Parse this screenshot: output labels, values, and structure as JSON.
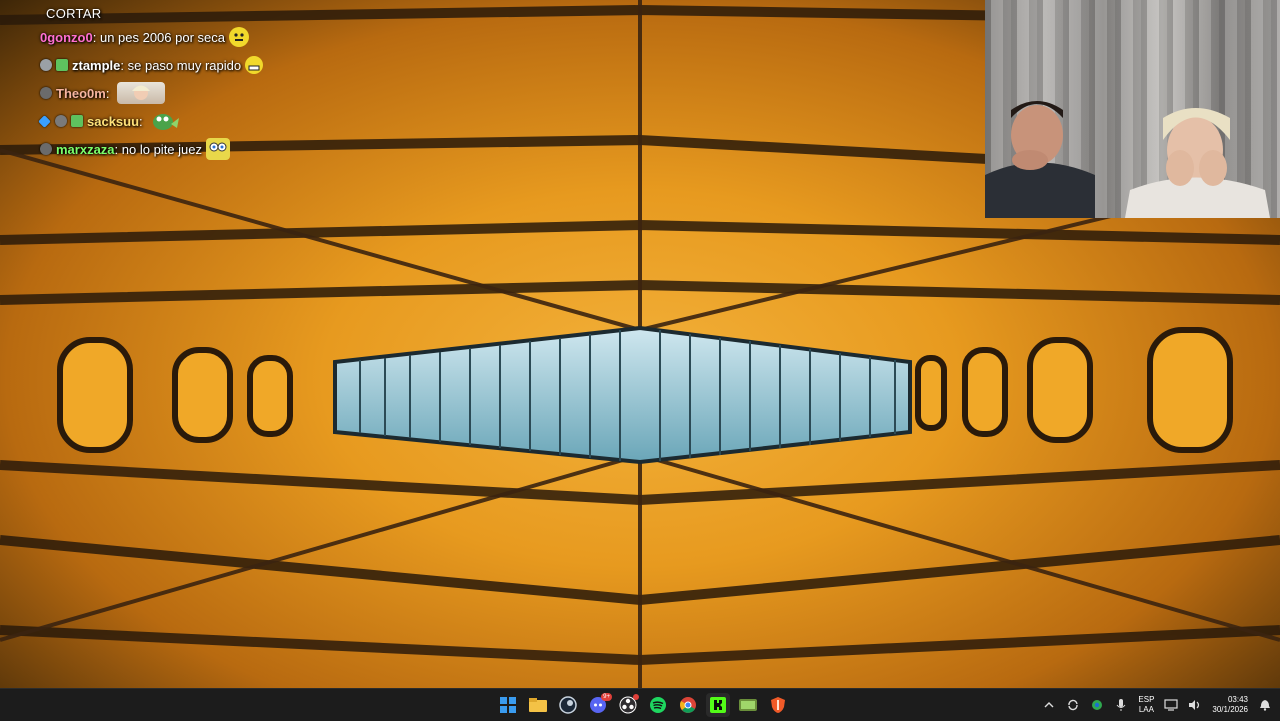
{
  "chat": {
    "title": "CORTAR",
    "messages": [
      {
        "user": "0gonzo0",
        "text": ": un pes 2006 por seca",
        "user_color": "#ff6fd0",
        "badge_colors": [],
        "emote": "neutral-face"
      },
      {
        "user": "ztample",
        "text": ": se paso muy rapido",
        "user_color": "#ffffff",
        "badge_colors": [
          "#9aa0a6",
          "#5ec25e"
        ],
        "emote": "grimace-face"
      },
      {
        "user": "Theo0m",
        "text": ":",
        "user_color": "#f7b5a0",
        "badge_colors": [
          "#6b6b6b"
        ],
        "emote": "girl-face"
      },
      {
        "user": "sacksuu",
        "text": ":",
        "user_color": "#ffe27a",
        "badge_colors": [
          "#3aa0ff",
          "#7a7a7a",
          "#5ec25e"
        ],
        "emote": "pepe-frog"
      },
      {
        "user": "marxzaza",
        "text": ": no lo pite juez",
        "user_color": "#7cff6b",
        "badge_colors": [
          "#6b6b6b"
        ],
        "emote": "spongebob"
      }
    ]
  },
  "webcam": {
    "description_icon": "webcam-feed"
  },
  "taskbar": {
    "apps": [
      {
        "name": "windows-start-icon",
        "color": "#3a9cf0"
      },
      {
        "name": "file-explorer-icon",
        "color": "#f4c246"
      },
      {
        "name": "steam-icon",
        "color": "#c9d4df"
      },
      {
        "name": "discord-icon",
        "color": "#5865f2",
        "badge": "9+"
      },
      {
        "name": "obs-icon",
        "color": "#ffffff"
      },
      {
        "name": "spotify-icon",
        "color": "#1ed760"
      },
      {
        "name": "chrome-icon",
        "color": "#f2b31a"
      },
      {
        "name": "kick-icon",
        "color": "#53fc18"
      },
      {
        "name": "game-icon",
        "color": "#9fd66a"
      },
      {
        "name": "shield-icon",
        "color": "#f05a28"
      }
    ],
    "tray": {
      "language_line1": "ESP",
      "language_line2": "LAA",
      "time": "03:43",
      "date": "30/1/2026"
    }
  }
}
